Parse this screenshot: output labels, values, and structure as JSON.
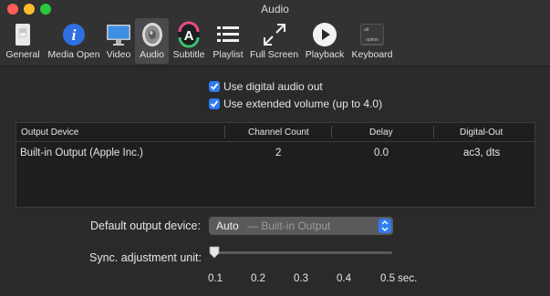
{
  "window": {
    "title": "Audio"
  },
  "toolbar": {
    "items": [
      {
        "label": "General",
        "icon": "general-switch-icon"
      },
      {
        "label": "Media Open",
        "icon": "info-icon"
      },
      {
        "label": "Video",
        "icon": "monitor-icon"
      },
      {
        "label": "Audio",
        "icon": "speaker-icon",
        "active": true
      },
      {
        "label": "Subtitle",
        "icon": "subtitle-a-icon"
      },
      {
        "label": "Playlist",
        "icon": "list-icon"
      },
      {
        "label": "Full Screen",
        "icon": "expand-arrows-icon"
      },
      {
        "label": "Playback",
        "icon": "play-icon"
      },
      {
        "label": "Keyboard",
        "icon": "keyboard-key-icon"
      }
    ],
    "keyboard_key_top": "alt",
    "keyboard_key_bottom": "option"
  },
  "options": {
    "digital_audio": {
      "label": "Use digital audio out",
      "checked": true
    },
    "extended_volume": {
      "label": "Use extended volume (up to 4.0)",
      "checked": true
    }
  },
  "device_table": {
    "headers": [
      "Output Device",
      "Channel Count",
      "Delay",
      "Digital-Out"
    ],
    "rows": [
      [
        "Built-in Output (Apple Inc.)",
        "2",
        "0.0",
        "ac3, dts"
      ]
    ]
  },
  "default_device": {
    "label": "Default output device:",
    "value": "Auto",
    "hint": "— Built-in Output"
  },
  "sync": {
    "label": "Sync. adjustment unit:",
    "ticks": [
      "0.1",
      "0.2",
      "0.3",
      "0.4",
      "0.5 sec."
    ],
    "selected": "0.1"
  },
  "colors": {
    "accent": "#2f7bf5",
    "background": "#2a2a2b"
  }
}
